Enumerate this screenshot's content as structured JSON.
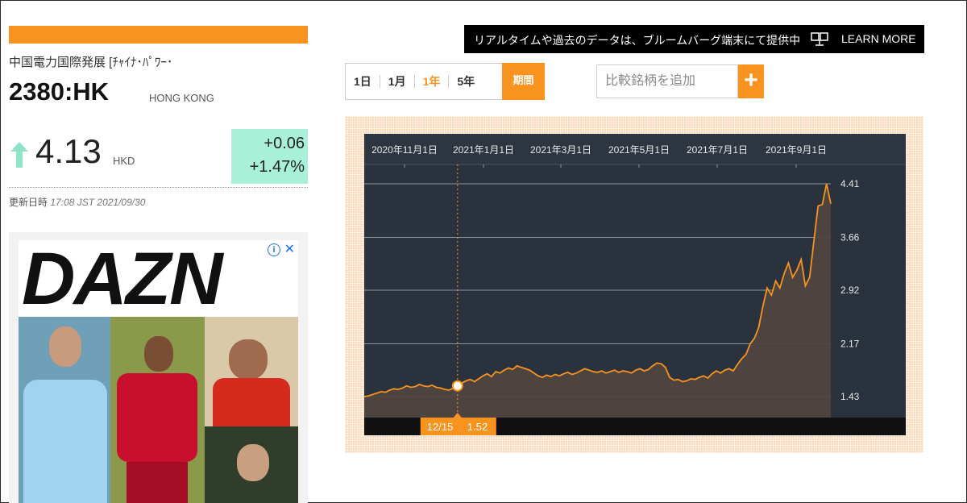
{
  "stock": {
    "company_name": "中国電力国際発展 [ﾁｬｲﾅ･ﾊﾟﾜｰ･",
    "ticker": "2380:HK",
    "exchange": "HONG KONG",
    "price": "4.13",
    "currency": "HKD",
    "change_abs": "+0.06",
    "change_pct": "+1.47%",
    "updated_label": "更新日時",
    "updated_value": "17:08 JST 2021/09/30",
    "direction_icon": "up-arrow-icon",
    "up_color": "#a8f0d8"
  },
  "ad": {
    "brand": "DAZN",
    "info_icon": "info-icon",
    "close_icon": "close-icon"
  },
  "promo": {
    "text": "リアルタイムや過去のデータは、ブルームバーグ端末にて提供中",
    "icon": "terminal-icon",
    "link": "LEARN MORE"
  },
  "controls": {
    "tabs": [
      "1日",
      "1月",
      "1年",
      "5年"
    ],
    "active_tab": "1年",
    "period_button": "期間",
    "compare_placeholder": "比較銘柄を追加",
    "compare_button": "+",
    "accent_color": "#f7931e"
  },
  "chart_data": {
    "type": "area",
    "x_tick_labels": [
      "2020年11月1日",
      "2021年1月1日",
      "2021年3月1日",
      "2021年5月1日",
      "2021年7月1日",
      "2021年9月1日"
    ],
    "y_tick_labels": [
      "4.41",
      "3.66",
      "2.92",
      "2.17",
      "1.43"
    ],
    "ylim": [
      1.43,
      4.41
    ],
    "series": [
      {
        "values": [
          1.43,
          1.44,
          1.46,
          1.48,
          1.5,
          1.49,
          1.52,
          1.54,
          1.53,
          1.55,
          1.58,
          1.56,
          1.57,
          1.6,
          1.58,
          1.57,
          1.59,
          1.56,
          1.55,
          1.53,
          1.52,
          1.55,
          1.58,
          1.62,
          1.65,
          1.67,
          1.64,
          1.68,
          1.72,
          1.75,
          1.71,
          1.78,
          1.76,
          1.8,
          1.83,
          1.81,
          1.86,
          1.84,
          1.82,
          1.8,
          1.76,
          1.72,
          1.7,
          1.73,
          1.71,
          1.74,
          1.72,
          1.75,
          1.77,
          1.74,
          1.76,
          1.79,
          1.82,
          1.8,
          1.78,
          1.77,
          1.79,
          1.76,
          1.78,
          1.8,
          1.77,
          1.79,
          1.78,
          1.76,
          1.8,
          1.82,
          1.79,
          1.81,
          1.86,
          1.9,
          1.89,
          1.84,
          1.7,
          1.66,
          1.67,
          1.64,
          1.65,
          1.68,
          1.67,
          1.7,
          1.72,
          1.69,
          1.75,
          1.79,
          1.76,
          1.8,
          1.82,
          1.79,
          1.88,
          1.96,
          2.02,
          2.17,
          2.25,
          2.4,
          2.7,
          2.95,
          2.85,
          3.05,
          2.95,
          3.15,
          3.3,
          3.1,
          3.2,
          3.35,
          2.98,
          3.1,
          3.6,
          4.1,
          4.12,
          4.41,
          4.13
        ]
      }
    ],
    "tooltip": {
      "date": "12/15",
      "value": "1.52"
    },
    "grid": true,
    "background": "#2a333d",
    "line_color": "#f7931e"
  }
}
